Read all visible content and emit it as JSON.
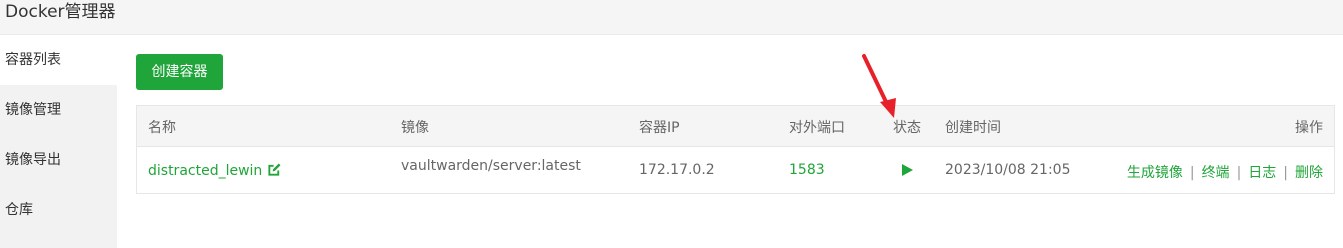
{
  "app": {
    "title": "Docker管理器"
  },
  "sidebar": {
    "items": [
      {
        "label": "容器列表"
      },
      {
        "label": "镜像管理"
      },
      {
        "label": "镜像导出"
      },
      {
        "label": "仓库"
      }
    ]
  },
  "toolbar": {
    "create_label": "创建容器"
  },
  "table": {
    "headers": {
      "name": "名称",
      "image": "镜像",
      "ip": "容器IP",
      "port": "对外端口",
      "status": "状态",
      "created": "创建时间",
      "actions": "操作"
    },
    "rows": [
      {
        "name": "distracted_lewin",
        "image": "vaultwarden/server:latest",
        "ip": "172.17.0.2",
        "port": "1583",
        "status_icon": "play-icon",
        "created": "2023/10/08 21:05",
        "actions": {
          "build_image": "生成镜像",
          "terminal": "终端",
          "logs": "日志",
          "delete": "删除",
          "separator": "|"
        }
      }
    ]
  },
  "colors": {
    "accent": "#20a53a",
    "annotation_arrow": "#e8202a"
  }
}
